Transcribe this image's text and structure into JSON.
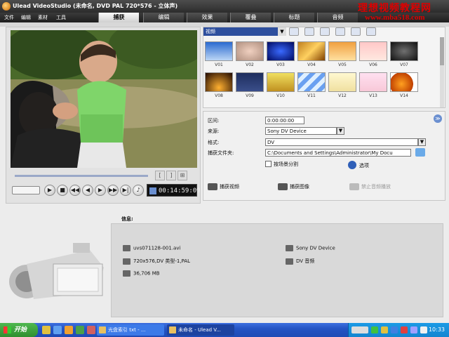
{
  "window": {
    "title": "Ulead VideoStudio (未命名, DVD PAL 720*576 - 立体声)"
  },
  "watermark": {
    "text": "理想视频教程网",
    "url": "www.mba518.com"
  },
  "menu": {
    "items": [
      "文件",
      "编辑",
      "素材",
      "工具"
    ]
  },
  "steps": {
    "tabs": [
      "捕获",
      "编辑",
      "效果",
      "覆叠",
      "标题",
      "音频"
    ],
    "active": "捕获"
  },
  "library": {
    "category": "视频",
    "thumbnails": [
      "V01",
      "V02",
      "V03",
      "V04",
      "V05",
      "V06",
      "V07",
      "V08",
      "V09",
      "V10",
      "V11",
      "V12",
      "V13",
      "V14"
    ]
  },
  "player": {
    "timecode": "00:14:59:09"
  },
  "capture_options": {
    "duration_label": "区间:",
    "duration_value": "0:00:00:00",
    "source_label": "来源:",
    "source_value": "Sony DV Device",
    "format_label": "格式:",
    "format_value": "DV",
    "folder_label": "捕获文件夹:",
    "folder_value": "C:\\Documents and Settings\\Administrator\\My Docu",
    "split_by_scene_label": "按场景分割",
    "options_label": "选项",
    "capture_video_label": "捕获视频",
    "capture_image_label": "捕获图像",
    "disable_audio_label": "禁止音频播放"
  },
  "info": {
    "title": "信息:",
    "filename": "uvs071128-001.avi",
    "format": "720x576,DV 类型-1,PAL",
    "disk_space": "36,706 MB",
    "device": "Sony DV Device",
    "audio": "DV 音频"
  },
  "taskbar": {
    "start_label": "开始",
    "tasks": [
      "光盘索引 txt - ...",
      "未命名 - Ulead V..."
    ],
    "clock": "10:33"
  }
}
